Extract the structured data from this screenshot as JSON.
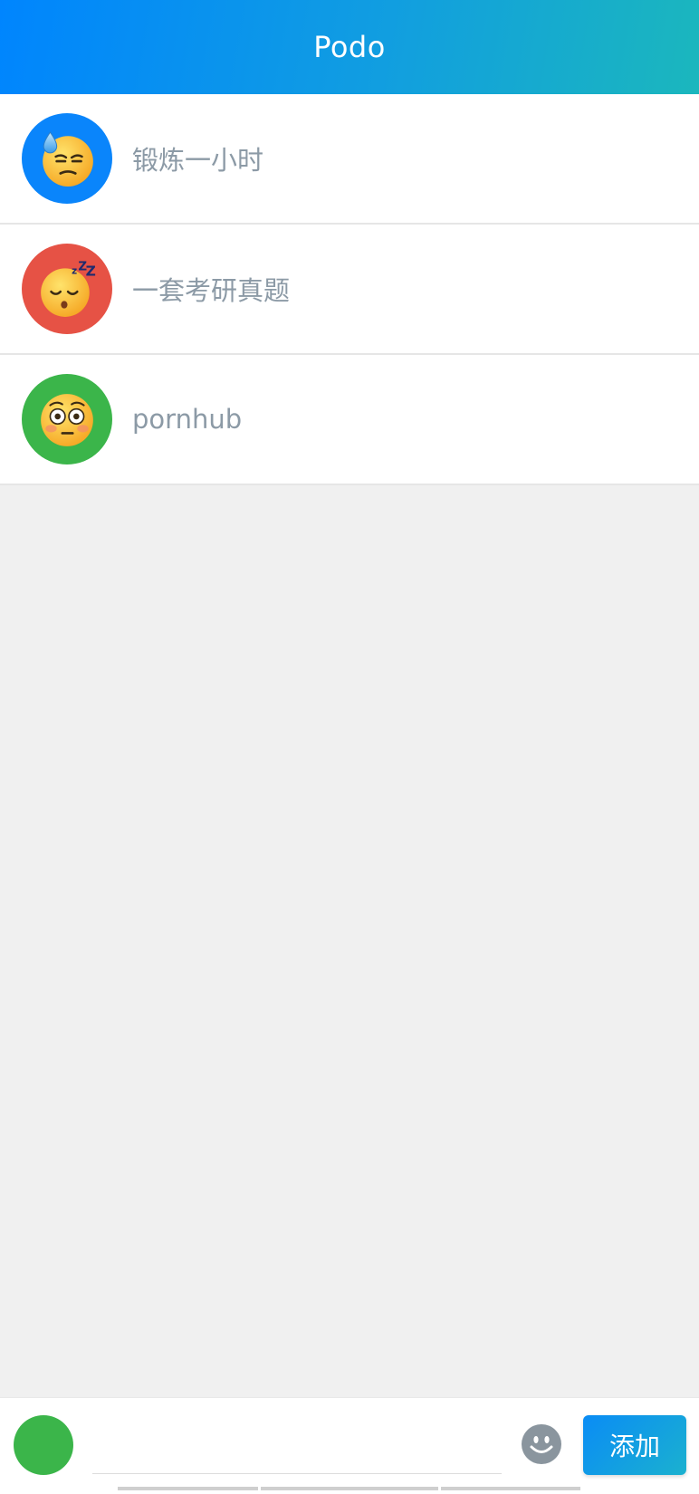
{
  "header": {
    "title": "Podo"
  },
  "todos": [
    {
      "label": "锻炼一小时",
      "color": "#0a85fb",
      "emoji": "downcast-sweat-face-icon"
    },
    {
      "label": "一套考研真题",
      "color": "#e65245",
      "emoji": "sleeping-face-icon"
    },
    {
      "label": "pornhub",
      "color": "#3bb54a",
      "emoji": "flushed-face-icon"
    }
  ],
  "composer": {
    "selected_color": "#3bb54a",
    "input_value": "",
    "input_placeholder": "",
    "emoji_button": "smiley-icon",
    "add_label": "添加"
  }
}
